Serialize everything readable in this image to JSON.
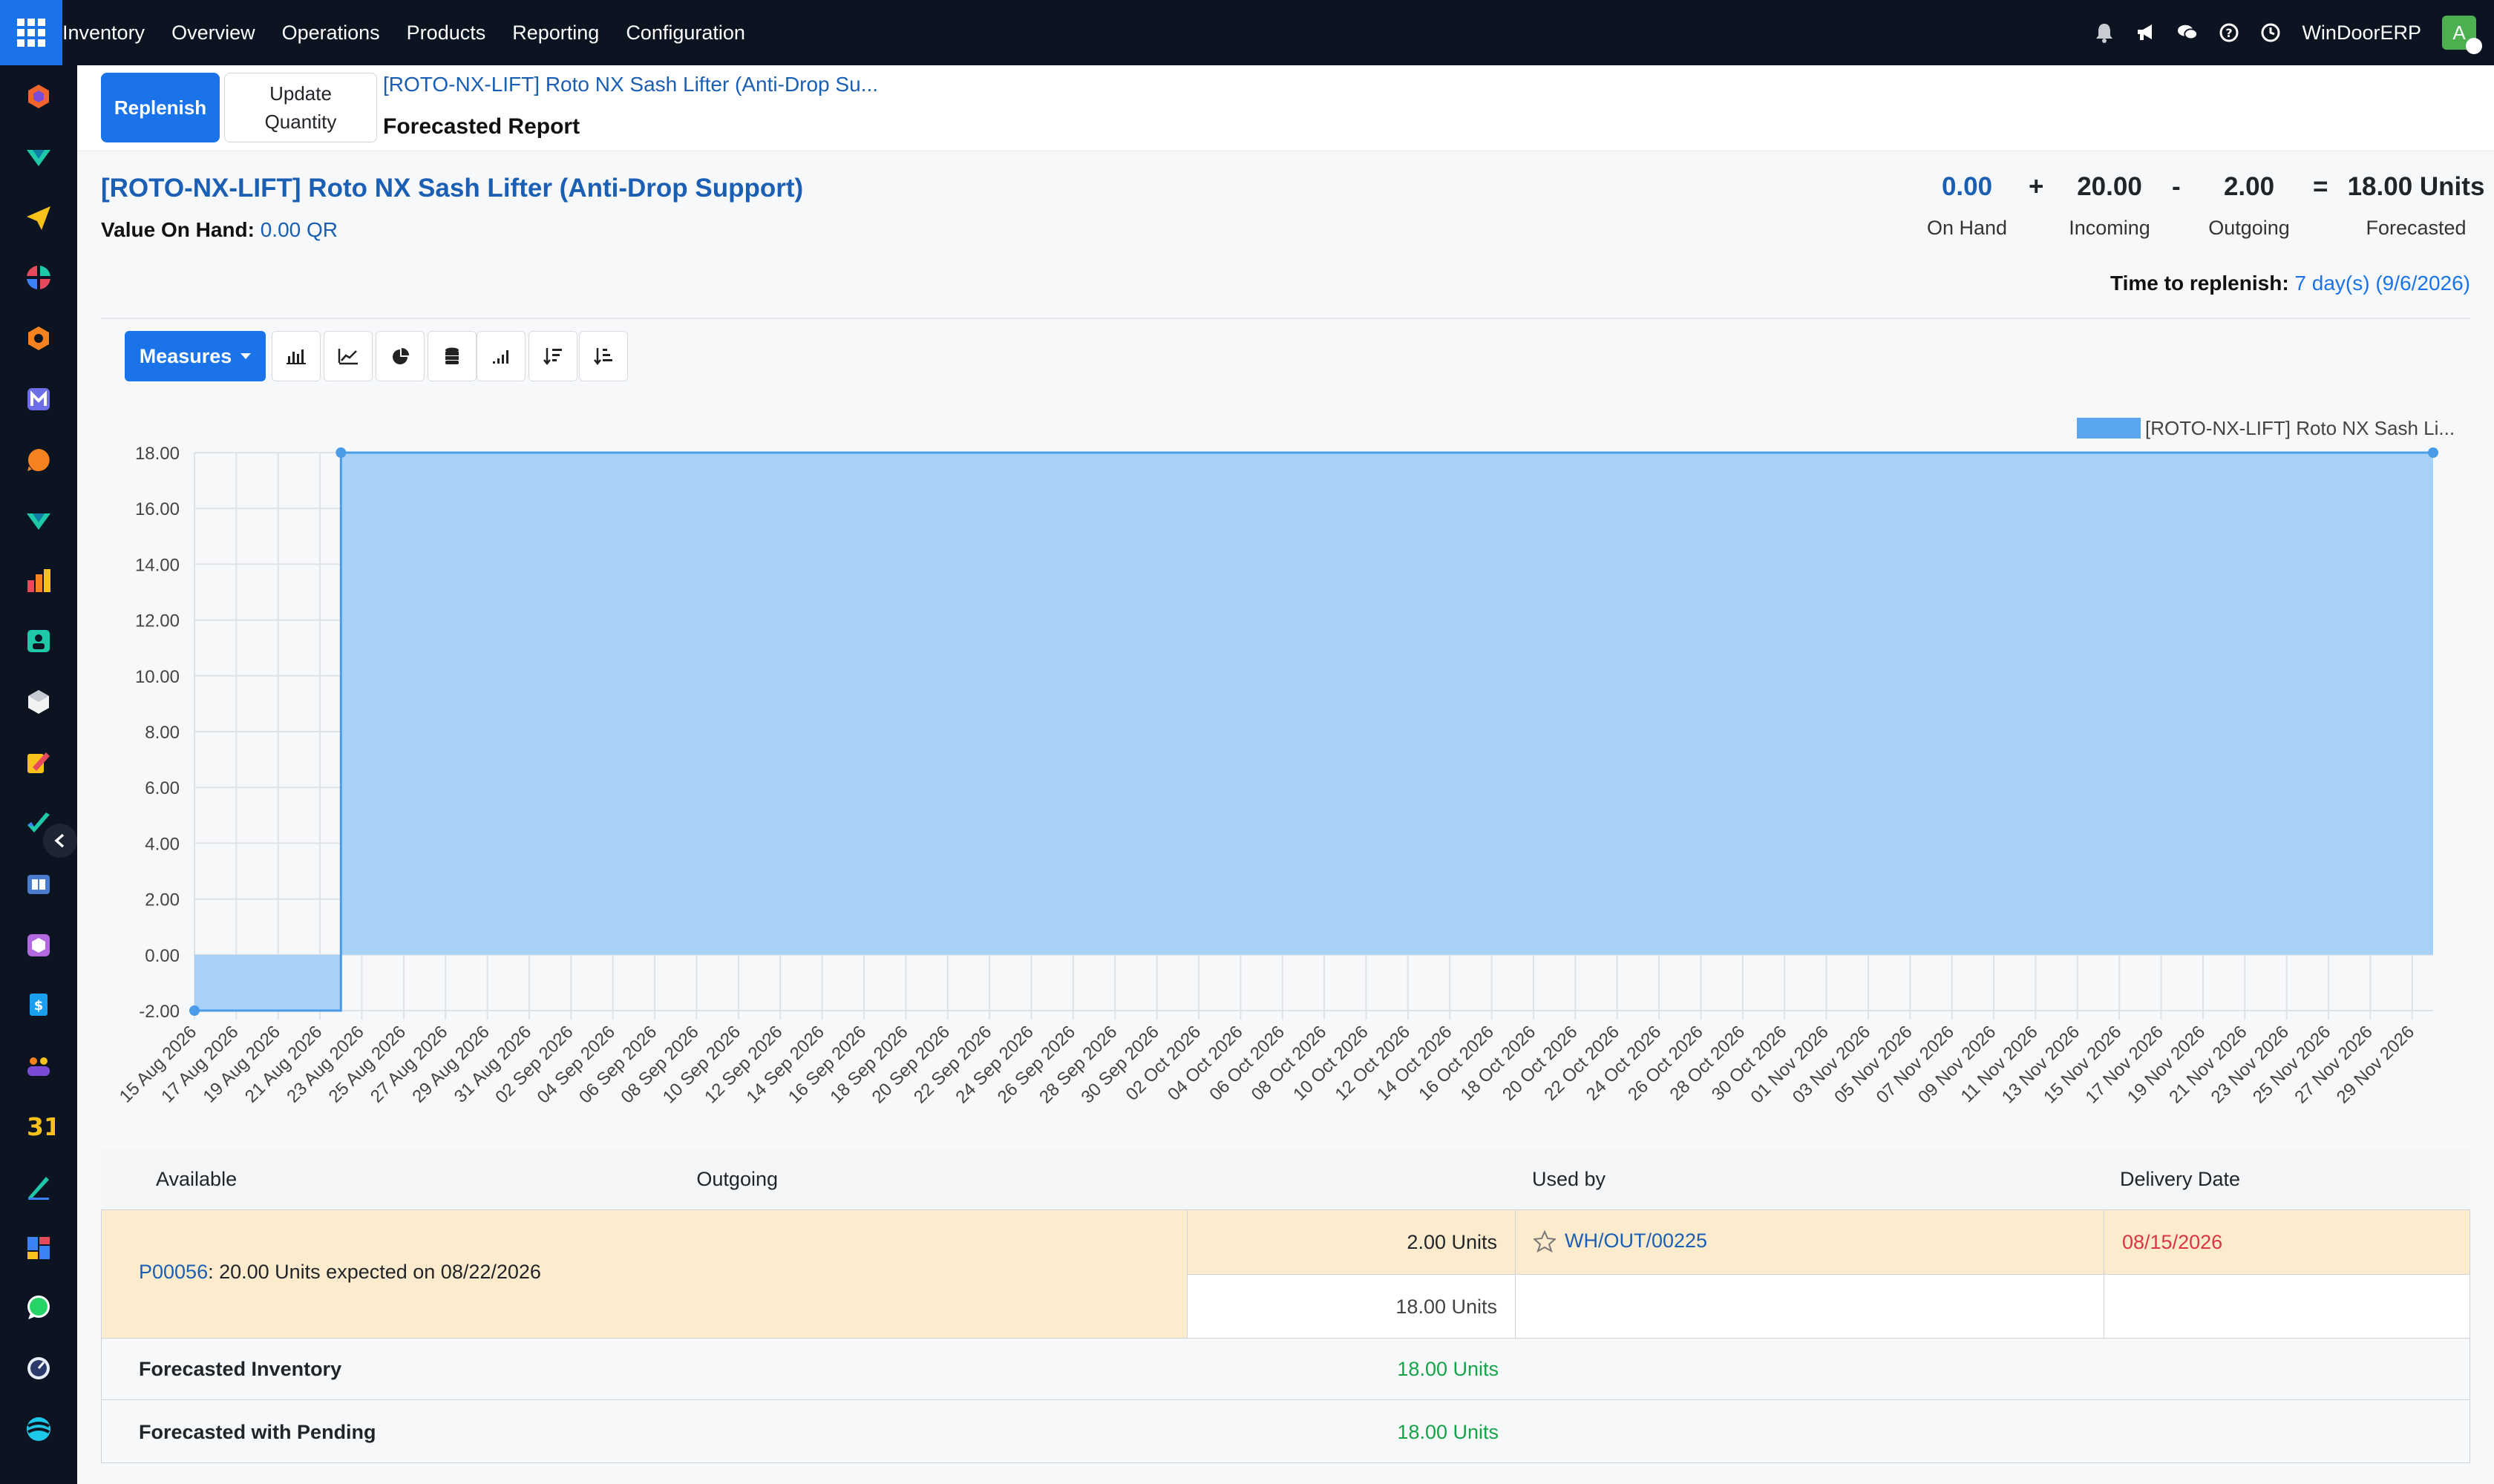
{
  "navbar": {
    "app_name": "Inventory",
    "menu": [
      "Overview",
      "Operations",
      "Products",
      "Reporting",
      "Configuration"
    ],
    "company": "WinDoorERP",
    "avatar_initial": "A",
    "icons": [
      "bell-icon",
      "megaphone-icon",
      "chat-icon",
      "help-icon",
      "clock-icon"
    ]
  },
  "sidebar": {
    "apps": [
      "app-icon-1",
      "app-icon-2",
      "app-icon-3",
      "app-icon-4",
      "app-icon-5",
      "app-icon-6",
      "app-icon-7",
      "app-icon-8",
      "app-icon-9",
      "app-icon-10",
      "app-icon-11",
      "app-icon-12",
      "app-icon-13",
      "app-icon-14",
      "app-icon-15",
      "app-icon-16",
      "app-icon-17",
      "app-icon-18",
      "app-icon-19",
      "app-icon-20",
      "app-icon-21",
      "app-icon-22",
      "app-icon-23",
      "app-icon-24"
    ],
    "calendar_label": "31"
  },
  "control": {
    "replenish_label": "Replenish",
    "update_quantity_label": "Update Quantity",
    "breadcrumb_link": "[ROTO-NX-LIFT] Roto NX Sash Lifter (Anti-Drop Su...",
    "breadcrumb_current": "Forecasted Report"
  },
  "header": {
    "product_title": "[ROTO-NX-LIFT] Roto NX Sash Lifter (Anti-Drop Support)",
    "value_on_hand_label": "Value On Hand:",
    "value_on_hand": "0.00 QR",
    "kpis": {
      "on_hand": {
        "value": "0.00",
        "label": "On Hand"
      },
      "incoming": {
        "value": "20.00",
        "label": "Incoming"
      },
      "outgoing": {
        "value": "2.00",
        "label": "Outgoing"
      },
      "forecasted": {
        "value": "18.00 Units",
        "label": "Forecasted"
      }
    },
    "operators": {
      "plus": "+",
      "minus": "-",
      "equals": "="
    },
    "time_to_replenish_label": "Time to replenish:",
    "time_to_replenish_value": "7 day(s) (9/6/2026)"
  },
  "toolbar": {
    "measures_label": "Measures",
    "tools": [
      "bar-chart-icon",
      "line-chart-icon",
      "pie-chart-icon",
      "stacked-icon",
      "cumulative-icon",
      "sort-descending-icon",
      "sort-ascending-icon"
    ]
  },
  "chart_data": {
    "type": "area",
    "legend": [
      "[ROTO-NX-LIFT] Roto NX Sash Li..."
    ],
    "legend_position": "top-right",
    "color": "#5aa6ee",
    "ylim": [
      -2,
      18
    ],
    "yticks": [
      "-2.00",
      "0.00",
      "2.00",
      "4.00",
      "6.00",
      "8.00",
      "10.00",
      "12.00",
      "14.00",
      "16.00",
      "18.00"
    ],
    "categories": [
      "15 Aug 2026",
      "17 Aug 2026",
      "19 Aug 2026",
      "21 Aug 2026",
      "23 Aug 2026",
      "25 Aug 2026",
      "27 Aug 2026",
      "29 Aug 2026",
      "31 Aug 2026",
      "02 Sep 2026",
      "04 Sep 2026",
      "06 Sep 2026",
      "08 Sep 2026",
      "10 Sep 2026",
      "12 Sep 2026",
      "14 Sep 2026",
      "16 Sep 2026",
      "18 Sep 2026",
      "20 Sep 2026",
      "22 Sep 2026",
      "24 Sep 2026",
      "26 Sep 2026",
      "28 Sep 2026",
      "30 Sep 2026",
      "02 Oct 2026",
      "04 Oct 2026",
      "06 Oct 2026",
      "08 Oct 2026",
      "10 Oct 2026",
      "12 Oct 2026",
      "14 Oct 2026",
      "16 Oct 2026",
      "18 Oct 2026",
      "20 Oct 2026",
      "22 Oct 2026",
      "24 Oct 2026",
      "26 Oct 2026",
      "28 Oct 2026",
      "30 Oct 2026",
      "01 Nov 2026",
      "03 Nov 2026",
      "05 Nov 2026",
      "07 Nov 2026",
      "09 Nov 2026",
      "11 Nov 2026",
      "13 Nov 2026",
      "15 Nov 2026",
      "17 Nov 2026",
      "19 Nov 2026",
      "21 Nov 2026",
      "23 Nov 2026",
      "25 Nov 2026",
      "27 Nov 2026",
      "29 Nov 2026"
    ],
    "points": [
      {
        "x": "15 Aug 2026",
        "y": -2
      },
      {
        "x": "22 Aug 2026",
        "y": -2
      },
      {
        "x": "22 Aug 2026",
        "y": 18
      },
      {
        "x": "30 Nov 2026",
        "y": 18
      }
    ],
    "grid": true
  },
  "table": {
    "headers": {
      "available": "Available",
      "outgoing": "Outgoing",
      "used_by": "Used by",
      "delivery_date": "Delivery Date"
    },
    "incoming_row": {
      "ref": "P00056",
      "text": ": 20.00 Units expected on 08/22/2026",
      "lines": [
        {
          "outgoing": "2.00 Units",
          "used_by": "WH/OUT/00225",
          "delivery_date": "08/15/2026"
        },
        {
          "outgoing": "18.00 Units",
          "used_by": "",
          "delivery_date": ""
        }
      ]
    },
    "forecasted_inventory": {
      "label": "Forecasted Inventory",
      "value": "18.00 Units"
    },
    "forecasted_pending": {
      "label": "Forecasted with Pending",
      "value": "18.00 Units"
    }
  }
}
